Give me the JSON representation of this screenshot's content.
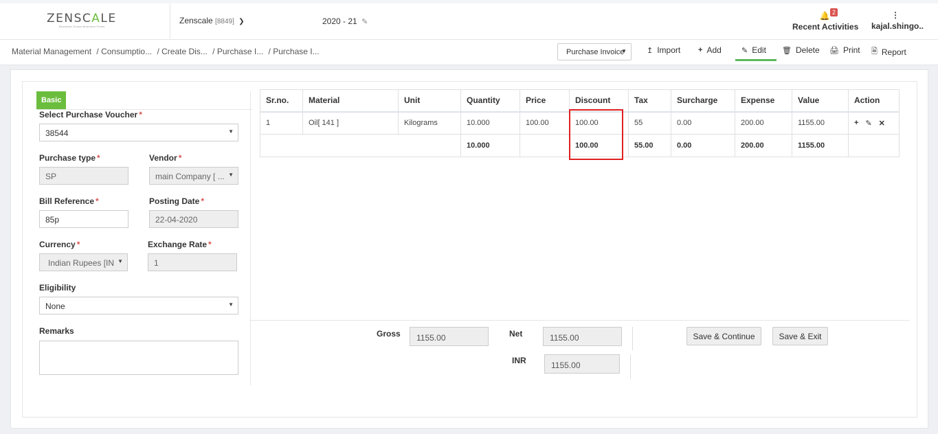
{
  "header": {
    "logo_text_a": "ZENSC",
    "logo_text_accent": "A",
    "logo_text_b": "LE",
    "logo_tagline": "Business Grows Business Flows",
    "company": "Zenscale",
    "company_code": "[8849]",
    "fiscal_year": "2020 - 21",
    "notifications_count": "2",
    "recent_activities": "Recent Activities",
    "user": "kajal.shingo.."
  },
  "breadcrumb": {
    "root": "Material Management",
    "items": [
      "/ Consumptio...",
      "/ Create Dis...",
      "/ Purchase I...",
      "/ Purchase I..."
    ]
  },
  "toolbar": {
    "voucher_type_selected": "Purchase Invoice",
    "import": "Import",
    "add": "Add",
    "edit": "Edit",
    "delete": "Delete",
    "print": "Print",
    "report": "Report"
  },
  "form": {
    "tab": "Basic",
    "select_voucher_label": "Select Purchase Voucher",
    "select_voucher_value": "38544",
    "purchase_type_label": "Purchase type",
    "purchase_type_value": "SP",
    "vendor_label": "Vendor",
    "vendor_value": "main Company [ ...",
    "bill_ref_label": "Bill Reference",
    "bill_ref_value": "85p",
    "posting_date_label": "Posting Date",
    "posting_date_value": "22-04-2020",
    "currency_label": "Currency",
    "currency_value": "Indian Rupees [IN",
    "exchange_rate_label": "Exchange Rate",
    "exchange_rate_value": "1",
    "eligibility_label": "Eligibility",
    "eligibility_value": "None",
    "remarks_label": "Remarks"
  },
  "table": {
    "columns": [
      "Sr.no.",
      "Material",
      "Unit",
      "Quantity",
      "Price",
      "Discount",
      "Tax",
      "Surcharge",
      "Expense",
      "Value",
      "Action"
    ],
    "row": {
      "sr": "1",
      "material": "Oil[ 141 ]",
      "unit": "Kilograms",
      "quantity": "10.000",
      "price": "100.00",
      "discount": "100.00",
      "tax": "55",
      "surcharge": "0.00",
      "expense": "200.00",
      "value": "1155.00"
    },
    "summary": {
      "quantity": "10.000",
      "discount": "100.00",
      "tax": "55.00",
      "surcharge": "0.00",
      "expense": "200.00",
      "value": "1155.00"
    }
  },
  "totals": {
    "gross_label": "Gross",
    "gross_value": "1155.00",
    "net_label": "Net",
    "net_value": "1155.00",
    "inr_label": "INR",
    "inr_value": "1155.00",
    "save_continue": "Save & Continue",
    "save_exit": "Save & Exit"
  },
  "colors": {
    "accent_green": "#6bbd3e",
    "highlight_red": "#e02020",
    "badge_red": "#d9534f"
  }
}
